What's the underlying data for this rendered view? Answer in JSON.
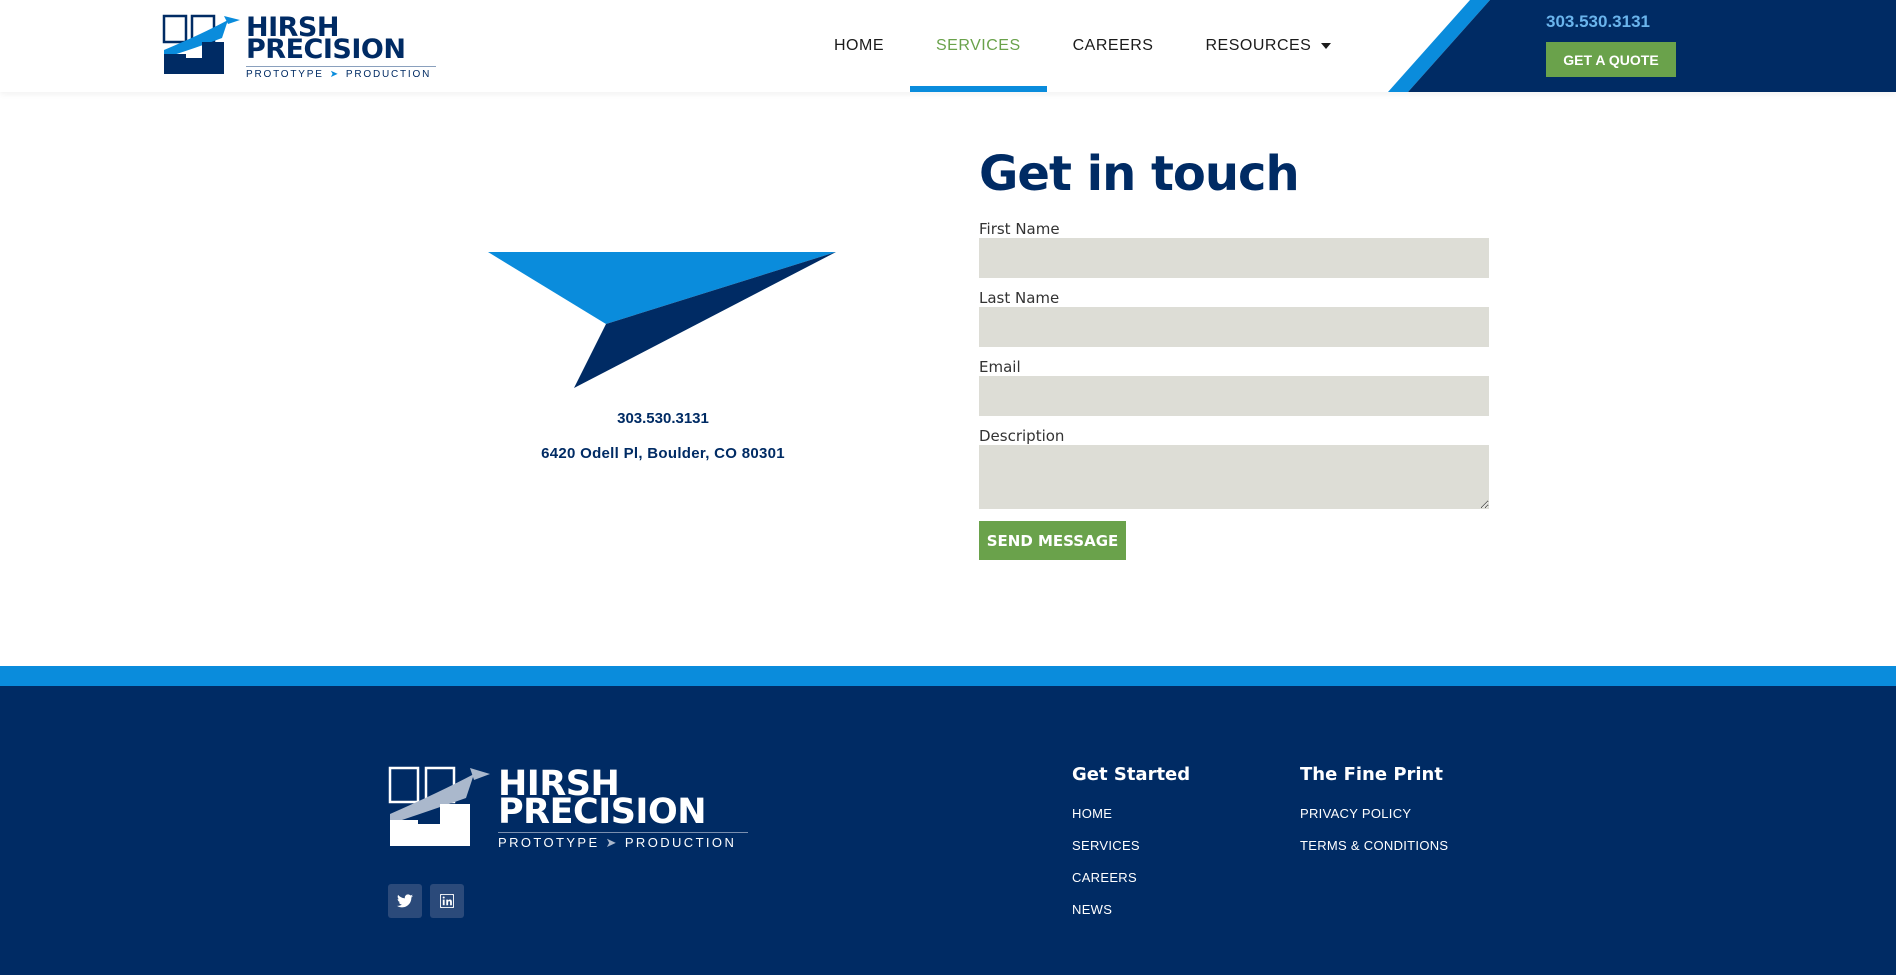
{
  "brand": {
    "name_line1": "HIRSH",
    "name_line2": "PRECISION",
    "tagline_left": "PROTOTYPE",
    "tagline_right": "PRODUCTION"
  },
  "nav": {
    "items": [
      {
        "label": "HOME",
        "active": false
      },
      {
        "label": "SERVICES",
        "active": true
      },
      {
        "label": "CAREERS",
        "active": false
      },
      {
        "label": "RESOURCES",
        "active": false,
        "has_dropdown": true
      }
    ]
  },
  "header": {
    "phone": "303.530.3131",
    "quote_label": "GET A QUOTE"
  },
  "contact": {
    "phone": "303.530.3131",
    "address": "6420 Odell Pl, Boulder, CO 80301"
  },
  "form": {
    "title": "Get in touch",
    "fields": [
      {
        "label": "First Name",
        "value": ""
      },
      {
        "label": "Last Name",
        "value": ""
      },
      {
        "label": "Email",
        "value": ""
      },
      {
        "label": "Description",
        "value": ""
      }
    ],
    "submit_label": "SEND MESSAGE"
  },
  "footer": {
    "social": [
      "twitter-icon",
      "linkedin-icon"
    ],
    "columns": [
      {
        "title": "Get Started",
        "links": [
          "HOME",
          "SERVICES",
          "CAREERS",
          "NEWS"
        ]
      },
      {
        "title": "The Fine Print",
        "links": [
          "PRIVACY POLICY",
          "TERMS & CONDITIONS"
        ]
      }
    ]
  },
  "colors": {
    "navy": "#002b64",
    "blue": "#0a8cdc",
    "green": "#6aa24b",
    "field_bg": "#ddddd6"
  }
}
